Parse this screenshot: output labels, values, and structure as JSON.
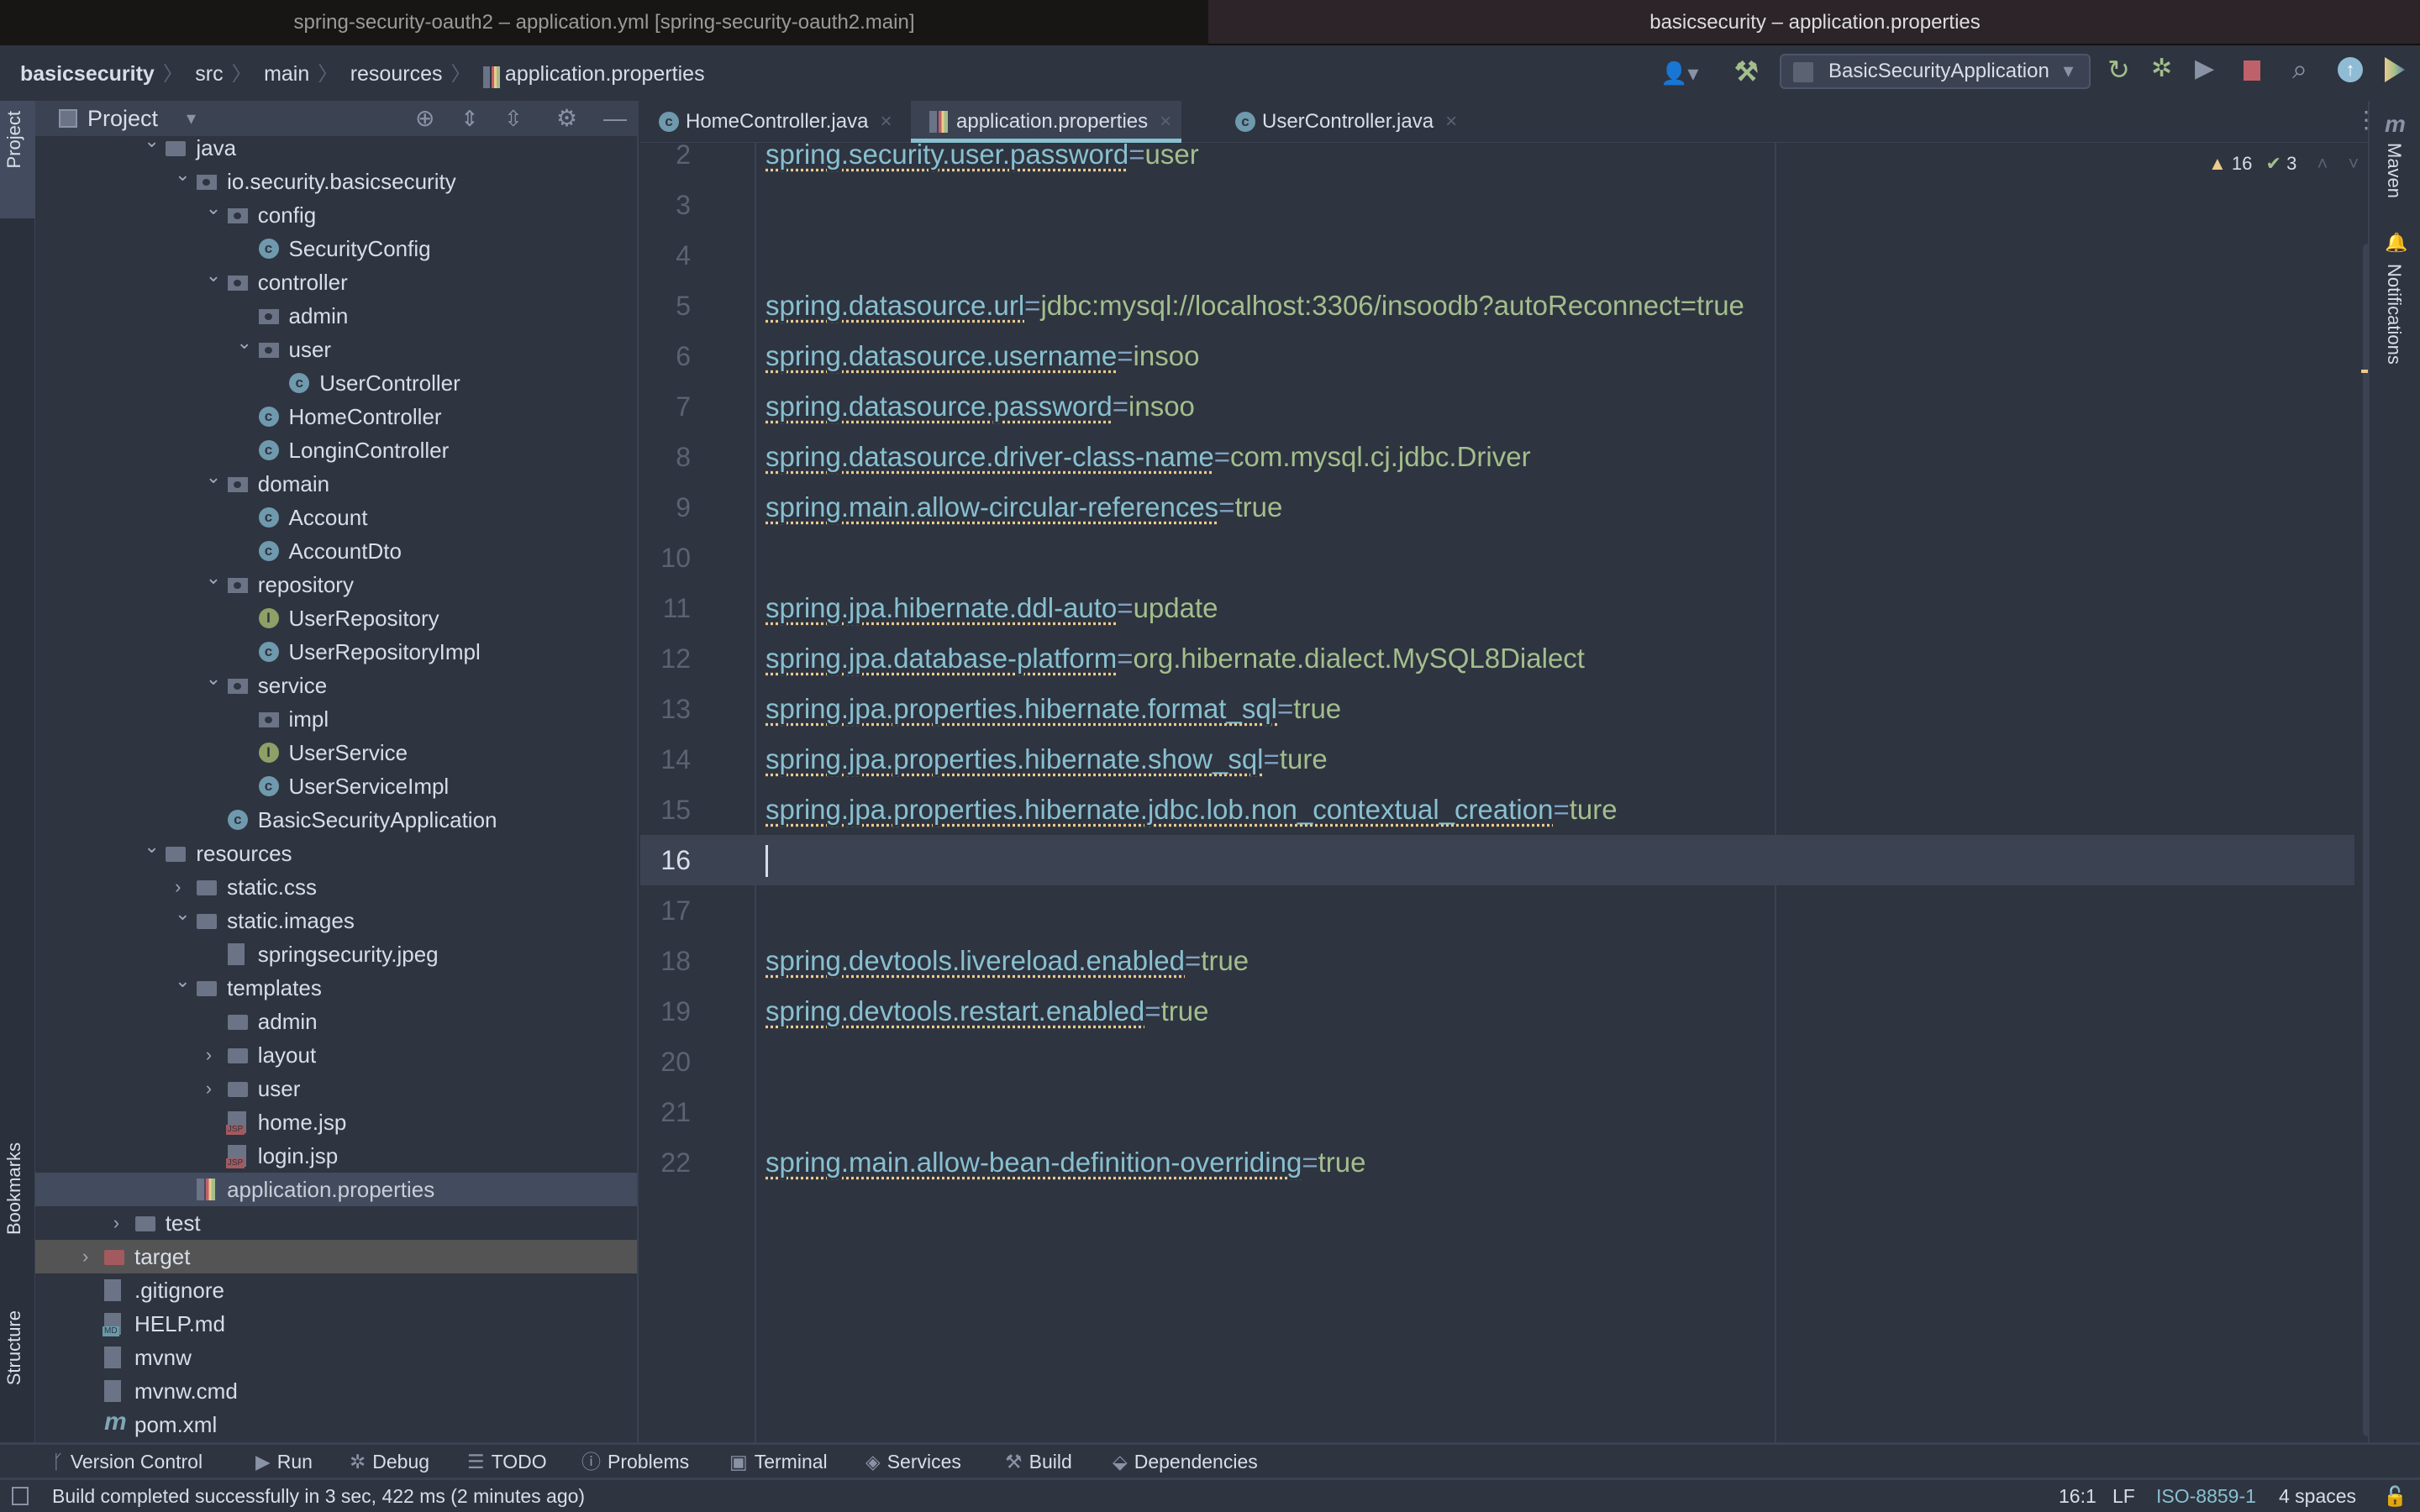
{
  "window_tabs": [
    "spring-security-oauth2 – application.yml [spring-security-oauth2.main]",
    "basicsecurity – application.properties"
  ],
  "breadcrumb": [
    "basicsecurity",
    "src",
    "main",
    "resources",
    "application.properties"
  ],
  "toolbar": {
    "run_config": "BasicSecurityApplication"
  },
  "project_panel": {
    "title": "Project"
  },
  "left_stripe": {
    "top": "Project",
    "bookmarks": "Bookmarks",
    "structure": "Structure"
  },
  "right_stripe": {
    "maven": "Maven",
    "notifications": "Notifications"
  },
  "tree": [
    {
      "label": "java",
      "depth": 0,
      "icon": "folder",
      "chevron": "open"
    },
    {
      "label": "io.security.basicsecurity",
      "depth": 1,
      "icon": "package",
      "chevron": "open"
    },
    {
      "label": "config",
      "depth": 2,
      "icon": "package",
      "chevron": "open"
    },
    {
      "label": "SecurityConfig",
      "depth": 3,
      "icon": "class"
    },
    {
      "label": "controller",
      "depth": 2,
      "icon": "package",
      "chevron": "open"
    },
    {
      "label": "admin",
      "depth": 3,
      "icon": "package"
    },
    {
      "label": "user",
      "depth": 3,
      "icon": "package",
      "chevron": "open"
    },
    {
      "label": "UserController",
      "depth": 4,
      "icon": "class"
    },
    {
      "label": "HomeController",
      "depth": 3,
      "icon": "class"
    },
    {
      "label": "LonginController",
      "depth": 3,
      "icon": "class"
    },
    {
      "label": "domain",
      "depth": 2,
      "icon": "package",
      "chevron": "open"
    },
    {
      "label": "Account",
      "depth": 3,
      "icon": "class"
    },
    {
      "label": "AccountDto",
      "depth": 3,
      "icon": "class"
    },
    {
      "label": "repository",
      "depth": 2,
      "icon": "package",
      "chevron": "open"
    },
    {
      "label": "UserRepository",
      "depth": 3,
      "icon": "interface"
    },
    {
      "label": "UserRepositoryImpl",
      "depth": 3,
      "icon": "class"
    },
    {
      "label": "service",
      "depth": 2,
      "icon": "package",
      "chevron": "open"
    },
    {
      "label": "impl",
      "depth": 3,
      "icon": "package"
    },
    {
      "label": "UserService",
      "depth": 3,
      "icon": "interface"
    },
    {
      "label": "UserServiceImpl",
      "depth": 3,
      "icon": "class"
    },
    {
      "label": "BasicSecurityApplication",
      "depth": 2,
      "icon": "class"
    },
    {
      "label": "resources",
      "depth": 0,
      "icon": "folder",
      "chevron": "open"
    },
    {
      "label": "static.css",
      "depth": 1,
      "icon": "folder",
      "chevron": "closed"
    },
    {
      "label": "static.images",
      "depth": 1,
      "icon": "folder",
      "chevron": "open"
    },
    {
      "label": "springsecurity.jpeg",
      "depth": 2,
      "icon": "image"
    },
    {
      "label": "templates",
      "depth": 1,
      "icon": "folder",
      "chevron": "open"
    },
    {
      "label": "admin",
      "depth": 2,
      "icon": "folder"
    },
    {
      "label": "layout",
      "depth": 2,
      "icon": "folder",
      "chevron": "closed"
    },
    {
      "label": "user",
      "depth": 2,
      "icon": "folder",
      "chevron": "closed"
    },
    {
      "label": "home.jsp",
      "depth": 2,
      "icon": "jsp"
    },
    {
      "label": "login.jsp",
      "depth": 2,
      "icon": "jsp"
    },
    {
      "label": "application.properties",
      "depth": 1,
      "icon": "properties",
      "selected": true
    },
    {
      "label": "test",
      "depth": -1,
      "icon": "folder",
      "chevron": "closed"
    },
    {
      "label": "target",
      "depth": -2,
      "icon": "folder-excluded",
      "chevron": "closed",
      "excluded": true
    },
    {
      "label": ".gitignore",
      "depth": -2,
      "icon": "file"
    },
    {
      "label": "HELP.md",
      "depth": -2,
      "icon": "markdown"
    },
    {
      "label": "mvnw",
      "depth": -2,
      "icon": "file"
    },
    {
      "label": "mvnw.cmd",
      "depth": -2,
      "icon": "file"
    },
    {
      "label": "pom.xml",
      "depth": -2,
      "icon": "maven"
    }
  ],
  "editor_tabs": [
    {
      "label": "HomeController.java",
      "icon": "class"
    },
    {
      "label": "application.properties",
      "icon": "properties",
      "active": true
    },
    {
      "label": "UserController.java",
      "icon": "class"
    }
  ],
  "inspections": {
    "warnings": "16",
    "weak_warnings": "3"
  },
  "code_lines": [
    {
      "n": "2",
      "key": "spring.security.user.password",
      "value": "user"
    },
    {
      "n": "3"
    },
    {
      "n": "4"
    },
    {
      "n": "5",
      "key": "spring.datasource.url",
      "value": "jdbc:mysql://localhost:3306/insoodb?autoReconnect=true"
    },
    {
      "n": "6",
      "key": "spring.datasource.username",
      "value": "insoo"
    },
    {
      "n": "7",
      "key": "spring.datasource.password",
      "value": "insoo"
    },
    {
      "n": "8",
      "key": "spring.datasource.driver-class-name",
      "value": "com.mysql.cj.jdbc.Driver"
    },
    {
      "n": "9",
      "key": "spring.main.allow-circular-references",
      "value": "true"
    },
    {
      "n": "10"
    },
    {
      "n": "11",
      "key": "spring.jpa.hibernate.ddl-auto",
      "value": "update"
    },
    {
      "n": "12",
      "key": "spring.jpa.database-platform",
      "value": "org.hibernate.dialect.MySQL8Dialect"
    },
    {
      "n": "13",
      "key": "spring.jpa.properties.hibernate.format_sql",
      "value": "true"
    },
    {
      "n": "14",
      "key": "spring.jpa.properties.hibernate.show_sql",
      "value": "ture"
    },
    {
      "n": "15",
      "key": "spring.jpa.properties.hibernate.jdbc.lob.non_contextual_creation",
      "value": "ture"
    },
    {
      "n": "16",
      "current": true
    },
    {
      "n": "17"
    },
    {
      "n": "18",
      "key": "spring.devtools.livereload.enabled",
      "value": "true"
    },
    {
      "n": "19",
      "key": "spring.devtools.restart.enabled",
      "value": "true"
    },
    {
      "n": "20"
    },
    {
      "n": "21"
    },
    {
      "n": "22",
      "key": "spring.main.allow-bean-definition-overriding",
      "value": "true"
    }
  ],
  "tool_windows": [
    {
      "label": "Version Control",
      "icon": "branch"
    },
    {
      "label": "Run",
      "icon": "play"
    },
    {
      "label": "Debug",
      "icon": "bug"
    },
    {
      "label": "TODO",
      "icon": "list"
    },
    {
      "label": "Problems",
      "icon": "problems"
    },
    {
      "label": "Terminal",
      "icon": "terminal"
    },
    {
      "label": "Services",
      "icon": "services"
    },
    {
      "label": "Build",
      "icon": "hammer"
    },
    {
      "label": "Dependencies",
      "icon": "dependencies"
    }
  ],
  "status": {
    "message": "Build completed successfully in 3 sec, 422 ms (2 minutes ago)",
    "position": "16:1",
    "line_sep": "LF",
    "encoding": "ISO-8859-1",
    "indent": "4 spaces"
  },
  "colors": {
    "background": "#2e3440",
    "key": "#88c0d0",
    "value": "#a3be8c",
    "equals": "#81a1c1",
    "accent": "#88c0d0"
  }
}
